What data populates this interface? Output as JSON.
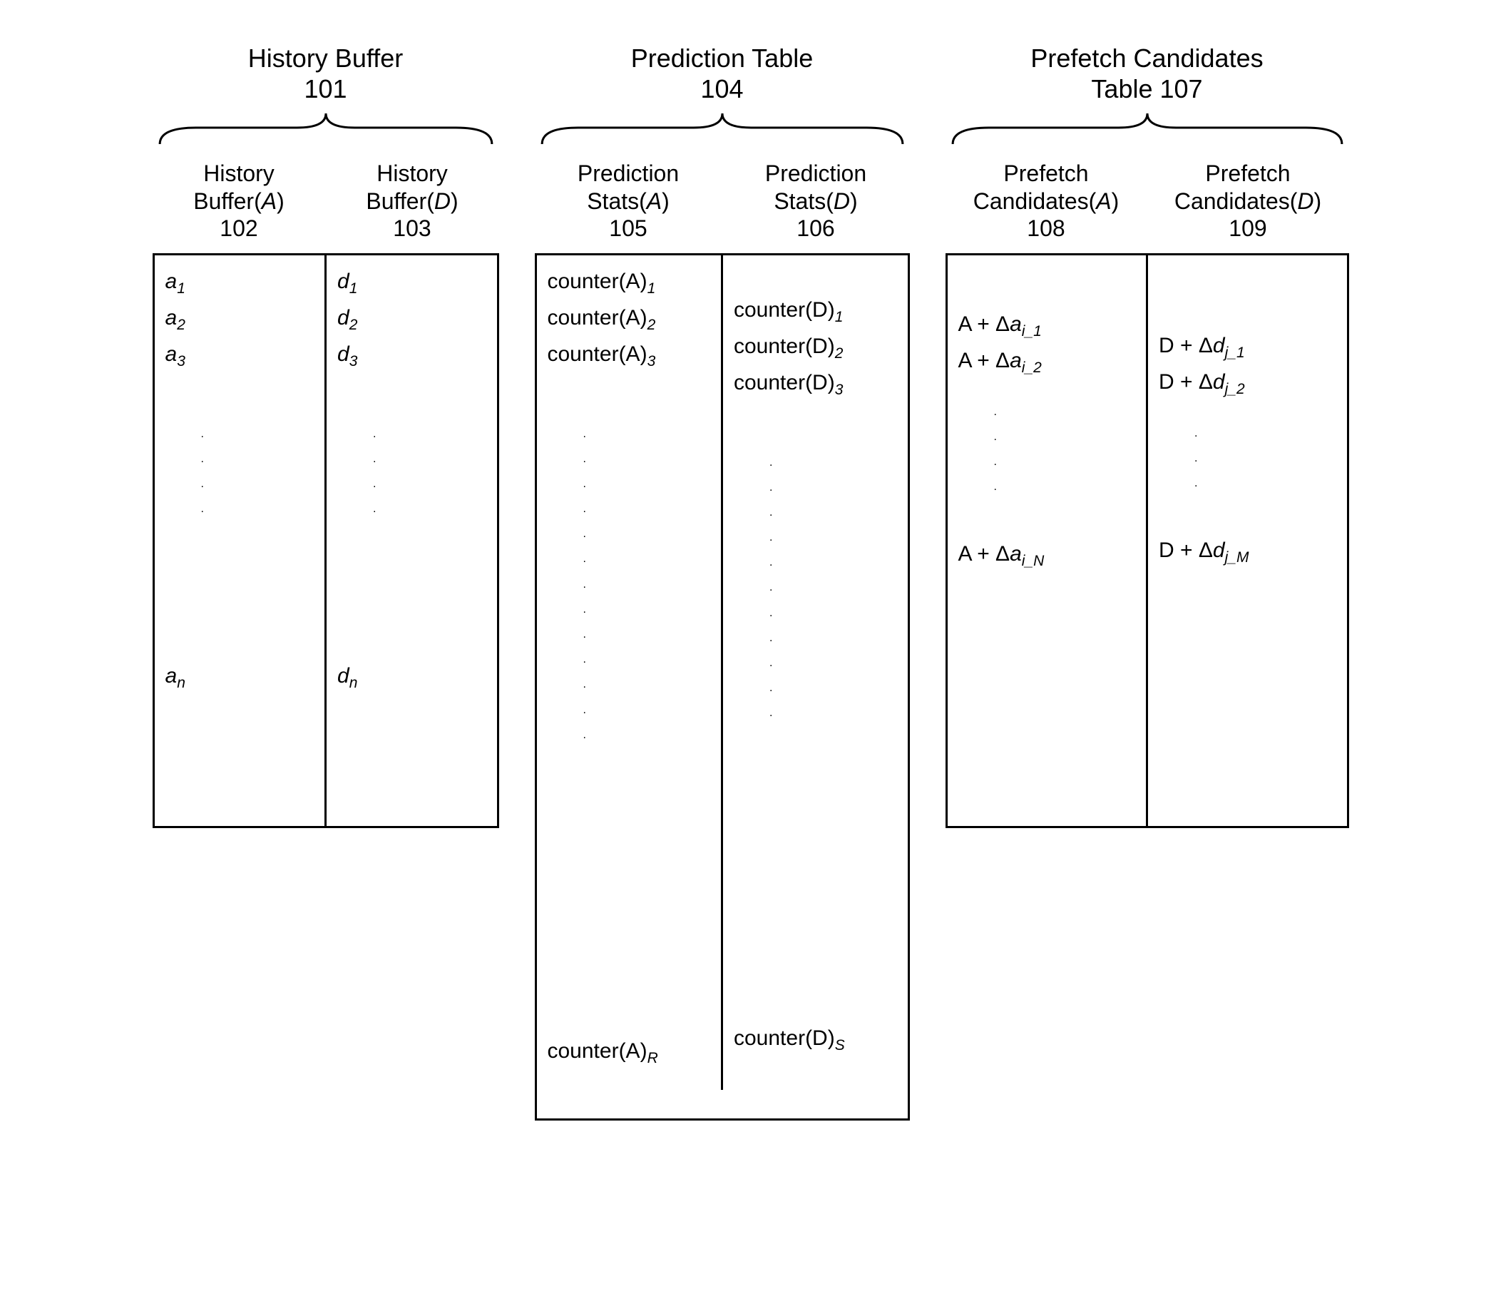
{
  "groups": {
    "hist": {
      "title_line1": "History Buffer",
      "title_line2": "101",
      "colA": {
        "h1": "History",
        "h2_pre": "Buffer(",
        "h2_var": "A",
        "h2_post": ")",
        "h3": "102"
      },
      "colD": {
        "h1": "History",
        "h2_pre": "Buffer(",
        "h2_var": "D",
        "h2_post": ")",
        "h3": "103"
      }
    },
    "pred": {
      "title_line1": "Prediction Table",
      "title_line2": "104",
      "colA": {
        "h1": "Prediction",
        "h2_pre": "Stats(",
        "h2_var": "A",
        "h2_post": ")",
        "h3": "105"
      },
      "colD": {
        "h1": "Prediction",
        "h2_pre": "Stats(",
        "h2_var": "D",
        "h2_post": ")",
        "h3": "106"
      }
    },
    "cand": {
      "title_line1": "Prefetch Candidates",
      "title_line2": "Table 107",
      "colA": {
        "h1": "Prefetch",
        "h2_pre": "Candidates(",
        "h2_var": "A",
        "h2_post": ")",
        "h3": "108"
      },
      "colD": {
        "h1": "Prefetch",
        "h2_pre": "Candidates(",
        "h2_var": "D",
        "h2_post": ")",
        "h3": "109"
      }
    }
  },
  "cells": {
    "hist_a": {
      "p": "a",
      "s1": "1",
      "s2": "2",
      "s3": "3",
      "sn": "n"
    },
    "hist_d": {
      "p": "d",
      "s1": "1",
      "s2": "2",
      "s3": "3",
      "sn": "n"
    },
    "pred_a": {
      "p": "counter(A)",
      "s1": "1",
      "s2": "2",
      "s3": "3",
      "sR": "R"
    },
    "pred_d": {
      "p": "counter(D)",
      "s1": "1",
      "s2": "2",
      "s3": "3",
      "sS": "S"
    },
    "cand_a": {
      "pfx": "A + Δ",
      "var": "a",
      "s1": "i_1",
      "s2": "i_2",
      "sN": "i_N"
    },
    "cand_d": {
      "pfx": "D + Δ",
      "var": "d",
      "s1": "j_1",
      "s2": "j_2",
      "sM": "j_M"
    }
  }
}
